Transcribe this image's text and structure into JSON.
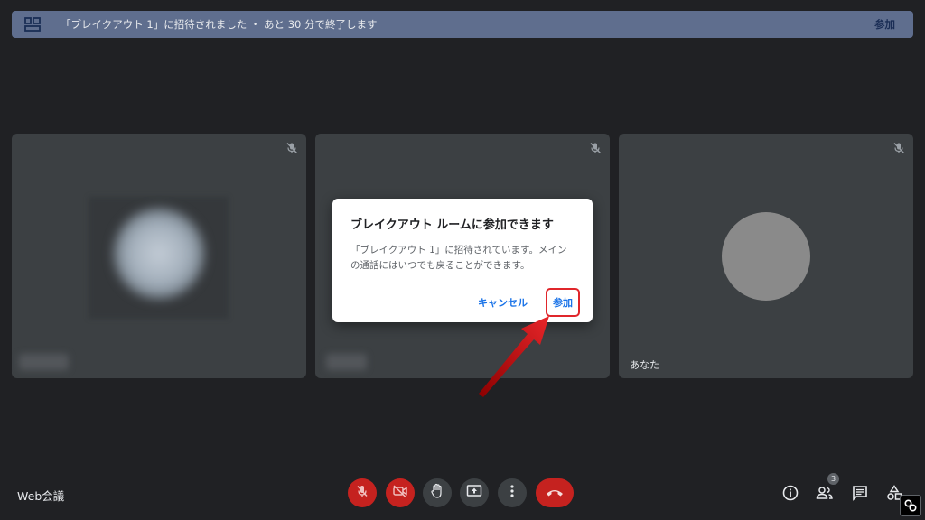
{
  "banner": {
    "icon": "breakout-room-icon",
    "message": "「ブレイクアウト 1」に招待されました ・ あと 30 分で終了します",
    "join_label": "参加"
  },
  "tiles": [
    {
      "name": "",
      "muted": true,
      "blurred": true
    },
    {
      "name": "",
      "muted": true,
      "blurred": true
    },
    {
      "name": "あなた",
      "muted": true,
      "blurred": false
    }
  ],
  "dialog": {
    "title": "ブレイクアウト ルームに参加できます",
    "body": "「ブレイクアウト 1」に招待されています。メインの通話にはいつでも戻ることができます。",
    "cancel_label": "キャンセル",
    "join_label": "参加"
  },
  "bottom_bar": {
    "meeting_name": "Web会議",
    "controls": [
      "mic-off-icon",
      "camera-off-icon",
      "raise-hand-icon",
      "present-screen-icon",
      "more-options-icon",
      "hangup-icon"
    ],
    "right_icons": [
      "info-icon",
      "people-icon",
      "chat-icon",
      "activities-icon"
    ],
    "participant_count": "3"
  },
  "colors": {
    "background": "#202124",
    "tile": "#3c4043",
    "banner": "#5f6e8e",
    "danger": "#c5221f",
    "link": "#1a73e8",
    "highlight": "#e0262b"
  }
}
